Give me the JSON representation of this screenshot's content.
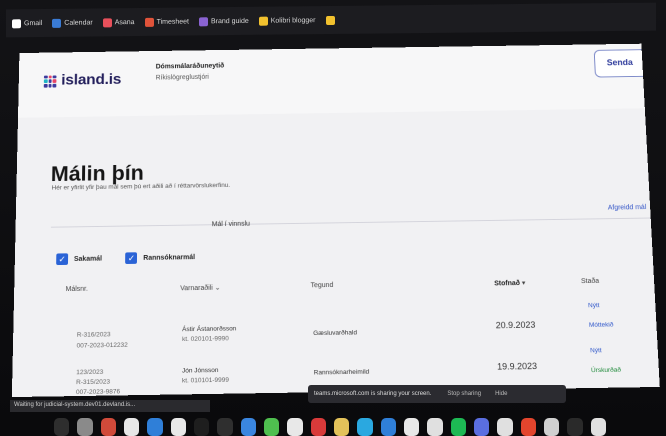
{
  "bookmarks": [
    {
      "label": "Gmail",
      "color": "#ffffff"
    },
    {
      "label": "Calendar",
      "color": "#3a7bd5"
    },
    {
      "label": "Asana",
      "color": "#e8505b"
    },
    {
      "label": "Timesheet",
      "color": "#e0533a"
    },
    {
      "label": "Brand guide",
      "color": "#8a63d2"
    },
    {
      "label": "Kolibri blogger",
      "color": "#f2c12e"
    },
    {
      "label": "",
      "color": "#f2c12e"
    }
  ],
  "header": {
    "logo_text": "island.is",
    "org_line1": "Dómsmálaráðuneytið",
    "org_line2": "Ríkislögreglustjóri",
    "send_button": "Senda"
  },
  "main": {
    "title": "Málin þín",
    "subtitle": "Hér er yfirlit yfir þau mál sem þú ert aðili að í réttarvörslukerfinu.",
    "tab_active": "Mál í vinnslu",
    "tab_done": "Afgreidd mál",
    "filters": [
      {
        "label": "Sakamál",
        "checked": true
      },
      {
        "label": "Rannsóknarmál",
        "checked": true
      }
    ],
    "columns": {
      "malsnr": "Málsnr.",
      "varnaraðili": "Varnaraðili",
      "tegund": "Tegund",
      "stofnad": "Stofnað",
      "stada": "Staða"
    },
    "rows": [
      {
        "case_no": "R-316/2023",
        "case_ref": "007-2023-012232",
        "defendant_name": "Ástir Ástanorðsson",
        "defendant_id": "kt. 020101-9990",
        "type": "Gæsluvarðhald",
        "date": "20.9.2023",
        "status1": "Nýtt",
        "status2": "Móttekið"
      },
      {
        "case_no": "123/2023",
        "case_ref2": "R-315/2023",
        "case_ref": "007-2023-9876",
        "defendant_name": "Jón Jónsson",
        "defendant_id": "kt. 010101-9999",
        "type": "Rannsóknarheimild",
        "date": "19.9.2023",
        "status1": "Nýtt",
        "status2": "Úrskurðað"
      }
    ]
  },
  "status_bar": "Waiting for judicial-system.dev01.devland.is...",
  "share_bar": {
    "message": "teams.microsoft.com is sharing your screen.",
    "stop": "Stop sharing",
    "hide": "Hide"
  },
  "dock_colors": [
    "#2e2e2e",
    "#8a8a8a",
    "#d04a3a",
    "#e7e7e7",
    "#2f7fd8",
    "#e8e8e8",
    "#1e1e1e",
    "#2f2f2f",
    "#3a86e0",
    "#4fbf4f",
    "#e8e8e8",
    "#d93a3a",
    "#e3c25a",
    "#2aa8e0",
    "#2f7fd8",
    "#e8e8e8",
    "#e0e0e0",
    "#1db954",
    "#5a6ee0",
    "#e0e0e0",
    "#e3452d",
    "#d0d0d0",
    "#2a2a2a",
    "#e0e0e0"
  ]
}
